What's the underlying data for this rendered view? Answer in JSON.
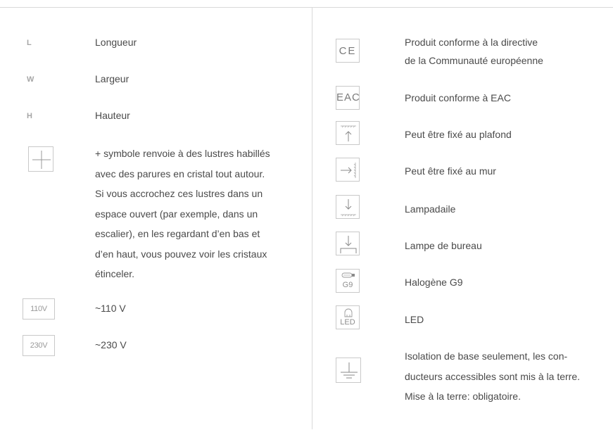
{
  "left": {
    "rows": [
      {
        "letter": "L",
        "text": "Longueur"
      },
      {
        "letter": "W",
        "text": "Largeur"
      },
      {
        "letter": "H",
        "text": "Hauteur"
      }
    ],
    "plus_text": "+ symbole renvoie à des lustres habillés\navec des parures en cristal tout autour.\nSi vous accrochez ces lustres dans un\nespace ouvert (par exemple, dans un\nescalier), en les regardant d’en bas et\nd’en haut, vous pouvez voir les cristaux\nétinceler.",
    "voltages": [
      {
        "badge": "110V",
        "text": "~110 V"
      },
      {
        "badge": "230V",
        "text": "~230 V"
      }
    ]
  },
  "right": {
    "ce_mark": "CE",
    "ce_text": "Produit conforme à la directive\nde la Communauté européenne",
    "eac_mark": "EAC",
    "eac_text": "Produit conforme à EAC",
    "ceiling_text": "Peut être fixé au plafond",
    "wall_text": "Peut être fixé au mur",
    "floor_text": "Lampadaile",
    "desk_text": "Lampe de bureau",
    "g9_badge": "G9",
    "g9_text": "Halogène G9",
    "led_badge": "LED",
    "led_text": "LED",
    "earth_text": "Isolation de base seulement, les con-\nducteurs accessibles sont mis à la terre.\nMise à la terre: obligatoire."
  },
  "colors": {
    "text": "#4a4a4a",
    "muted": "#a6a6a6",
    "rule": "#d9d9d9",
    "border": "#c9c9c9"
  }
}
